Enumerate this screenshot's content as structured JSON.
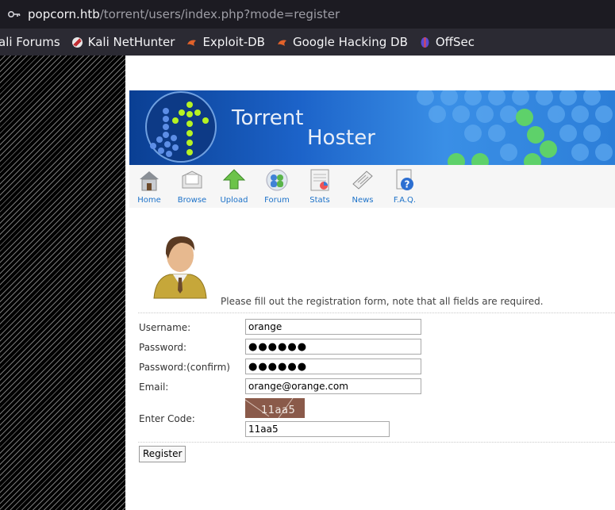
{
  "browser": {
    "url_host": "popcorn.htb",
    "url_path": "/torrent/users/index.php?mode=register",
    "bookmarks": [
      {
        "label": "ali Forums",
        "icon": "kali-forums-icon"
      },
      {
        "label": "Kali NetHunter",
        "icon": "kali-nethunter-icon"
      },
      {
        "label": "Exploit-DB",
        "icon": "exploit-db-icon"
      },
      {
        "label": "Google Hacking DB",
        "icon": "ghdb-icon"
      },
      {
        "label": "OffSec",
        "icon": "offsec-icon"
      }
    ]
  },
  "banner": {
    "title_line1": "Torrent",
    "title_line2": "Hoster"
  },
  "nav": {
    "items": [
      {
        "label": "Home",
        "icon": "home-icon"
      },
      {
        "label": "Browse",
        "icon": "browse-icon"
      },
      {
        "label": "Upload",
        "icon": "upload-icon"
      },
      {
        "label": "Forum",
        "icon": "forum-icon"
      },
      {
        "label": "Stats",
        "icon": "stats-icon"
      },
      {
        "label": "News",
        "icon": "news-icon"
      },
      {
        "label": "F.A.Q.",
        "icon": "faq-icon"
      }
    ]
  },
  "form": {
    "instructions": "Please fill out the registration form, note that all fields are required.",
    "username_label": "Username:",
    "username_value": "orange",
    "password_label": "Password:",
    "password_value": "●●●●●●",
    "password_confirm_label": "Password:(confirm)",
    "password_confirm_value": "●●●●●●",
    "email_label": "Email:",
    "email_value": "orange@orange.com",
    "code_label": "Enter Code:",
    "captcha_text": "11aa5",
    "code_value": "11aa5",
    "register_label": "Register"
  }
}
